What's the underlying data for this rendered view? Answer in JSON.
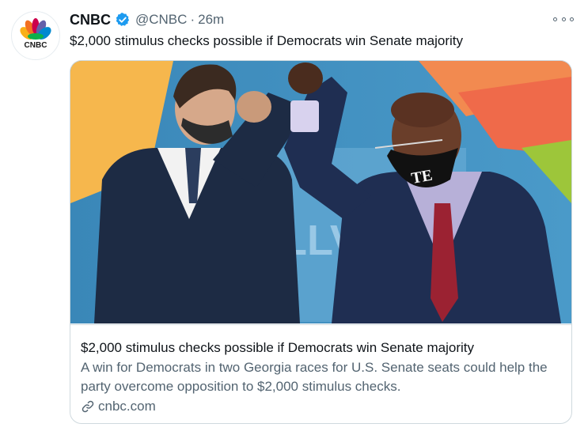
{
  "author": {
    "name": "CNBC",
    "handle": "@CNBC",
    "separator": "·",
    "time": "26m",
    "logo_text": "CNBC"
  },
  "tweet": {
    "text": "$2,000 stimulus checks possible if Democrats win Senate majority"
  },
  "card": {
    "title": "$2,000 stimulus checks possible if Democrats win Senate majority",
    "description": "A win for Democrats in two Georgia races for U.S. Senate seats could help the party overcome opposition to $2,000 stimulus checks.",
    "domain": "cnbc.com",
    "image_mask_text": "TE"
  },
  "icons": {
    "verified": "verified-badge-icon",
    "more": "more-options-icon",
    "link": "link-icon"
  },
  "colors": {
    "text": "#0f1419",
    "secondary": "#536471",
    "verified_blue": "#1d9bf0",
    "border": "#cfd9de"
  }
}
